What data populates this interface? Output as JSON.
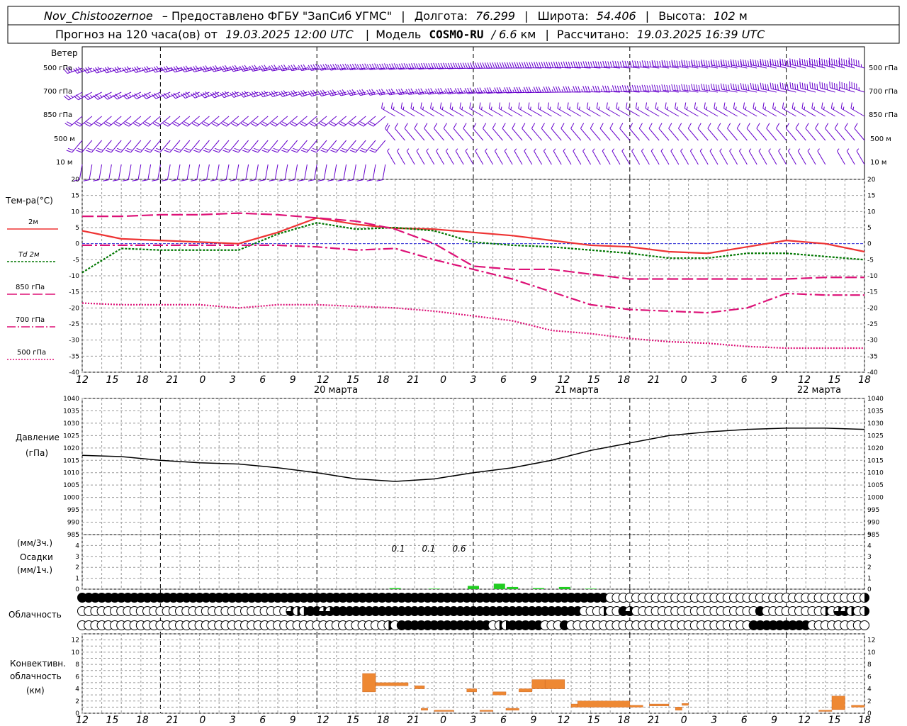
{
  "header": {
    "station": "Nov_Chistoozernoe",
    "provider_text": "– Предоставлено ФГБУ \"ЗапСиб УГМС\"",
    "lon_label": "Долгота:",
    "lon_value": "76.299",
    "lat_label": "Широта:",
    "lat_value": "54.406",
    "alt_label": "Высота:",
    "alt_value": "102",
    "alt_unit": "м",
    "forecast_label": "Прогноз на 120 часа(ов) от",
    "forecast_start": "19.03.2025 12:00 UTC",
    "model_label": "Модель",
    "model_name": "COSMO-RU",
    "model_res": "/ 6.6",
    "model_res_unit": "км",
    "calc_label": "Рассчитано:",
    "calc_time": "19.03.2025 16:39 UTC"
  },
  "time_axis": {
    "hour_labels": [
      "12",
      "15",
      "18",
      "21",
      "0",
      "3",
      "6",
      "9",
      "12",
      "15",
      "18",
      "21",
      "0",
      "3",
      "6",
      "9",
      "12",
      "15",
      "18",
      "21",
      "0",
      "3",
      "6",
      "9",
      "12",
      "15",
      "18"
    ],
    "dates": [
      "20 марта",
      "21 марта",
      "22 марта"
    ]
  },
  "colors": {
    "t2m": "#ee3333",
    "td2m": "#007700",
    "upper": "#dd1177",
    "wind": "#6600cc",
    "pressure": "#000000",
    "precip": "#22cc22",
    "convective": "#ee8833",
    "zero_line": "#3333dd",
    "grid": "#999999"
  },
  "wind_panel": {
    "title": "Ветер",
    "levels": [
      "500 гПа",
      "700 гПа",
      "850 гПа",
      "500 м",
      "10  м"
    ]
  },
  "temp_panel": {
    "title": "Тем-ра(°С)",
    "legend": [
      {
        "id": "t2m",
        "label": "2м"
      },
      {
        "id": "td2m",
        "label": "Td  2м"
      },
      {
        "id": "t850",
        "label": "850 гПа"
      },
      {
        "id": "t700",
        "label": "700 гПа"
      },
      {
        "id": "t500",
        "label": "500 гПа"
      }
    ],
    "y_ticks": [
      "20",
      "15",
      "10",
      "5",
      "0",
      "-5",
      "-10",
      "-15",
      "-20",
      "-25",
      "-30",
      "-35",
      "-40"
    ]
  },
  "pressure_panel": {
    "title": "Давление",
    "unit": "(гПа)",
    "y_ticks": [
      "1040",
      "1035",
      "1030",
      "1025",
      "1020",
      "1015",
      "1010",
      "1005",
      "1000",
      "995",
      "990",
      "985"
    ]
  },
  "precip_panel": {
    "unit_top": "(мм/3ч.)",
    "title": "Осадки",
    "unit_bottom": "(мм/1ч.)",
    "y_ticks": [
      "5",
      "4",
      "3",
      "2",
      "1",
      "0"
    ],
    "totals": [
      "0.1",
      "0.1",
      "0.6"
    ]
  },
  "cloud_panel": {
    "title": "Облачность"
  },
  "conv_panel": {
    "title_1": "Конвективн.",
    "title_2": "облачность",
    "unit": "(км)",
    "y_ticks": [
      "12",
      "10",
      "8",
      "6",
      "4",
      "2",
      "0"
    ]
  },
  "chart_data": {
    "type": "line",
    "x_hours": [
      0,
      6,
      12,
      18,
      24,
      30,
      36,
      42,
      48,
      54,
      60,
      66,
      72,
      78,
      84,
      90,
      96,
      102,
      108,
      114,
      120
    ],
    "series": [
      {
        "name": "2м",
        "values": [
          4,
          1.5,
          1,
          0.5,
          0,
          3.5,
          8,
          6,
          4.8,
          4.5,
          3.5,
          2.5,
          1,
          -0.5,
          -1,
          -2.5,
          -3,
          -1,
          1,
          0,
          -2.5
        ]
      },
      {
        "name": "Td  2м",
        "values": [
          -9,
          -1.5,
          -2,
          -2,
          -2,
          3,
          6.5,
          4.5,
          5,
          4,
          0.5,
          -0.5,
          -1,
          -2,
          -3,
          -4.5,
          -4.5,
          -3,
          -3,
          -4,
          -5
        ]
      },
      {
        "name": "850 гПа",
        "values": [
          8.5,
          8.5,
          9,
          9,
          9.5,
          9,
          8,
          7,
          4.5,
          0,
          -7,
          -8,
          -8,
          -9.5,
          -11,
          -11,
          -11,
          -11,
          -11,
          -10.5,
          -10.5
        ]
      },
      {
        "name": "700 гПа",
        "values": [
          -0.5,
          -0.5,
          -0.5,
          -0.5,
          -0.5,
          -0.5,
          -1,
          -2,
          -1.5,
          -5,
          -8,
          -11,
          -15,
          -19,
          -20.5,
          -21,
          -21.5,
          -20,
          -15.5,
          -16,
          -16
        ]
      },
      {
        "name": "500 гПа",
        "values": [
          -18.5,
          -19,
          -19,
          -19,
          -20,
          -19,
          -19,
          -19.5,
          -20,
          -21,
          -22.5,
          -24,
          -27,
          -28,
          -29.5,
          -30.5,
          -31,
          -32,
          -32.5,
          -32.5,
          -32.5
        ]
      }
    ],
    "pressure": {
      "values": [
        1017,
        1016.5,
        1015,
        1014,
        1013.5,
        1012,
        1010,
        1007.5,
        1006.5,
        1007.5,
        1010,
        1012,
        1015,
        1019,
        1022,
        1025,
        1026.5,
        1027.5,
        1028,
        1028,
        1027.5
      ],
      "ylim": [
        985,
        1040
      ]
    },
    "precip_3h": {
      "hours": [
        48,
        54,
        60,
        64,
        66,
        70,
        74,
        78
      ],
      "values": [
        0.1,
        0.05,
        0.3,
        0.5,
        0.2,
        0.1,
        0.2,
        0.05
      ]
    },
    "convective": {
      "segments": [
        {
          "from": 43,
          "to": 45,
          "bottom": 3.5,
          "top": 6.5
        },
        {
          "from": 45,
          "to": 50,
          "bottom": 4.5,
          "top": 5
        },
        {
          "from": 51,
          "to": 52.5,
          "bottom": 4,
          "top": 4.5
        },
        {
          "from": 52,
          "to": 53,
          "bottom": 0.5,
          "top": 0.8
        },
        {
          "from": 54,
          "to": 57,
          "bottom": 0.3,
          "top": 0.5
        },
        {
          "from": 59,
          "to": 60.5,
          "bottom": 3.5,
          "top": 4
        },
        {
          "from": 61,
          "to": 63,
          "bottom": 0.3,
          "top": 0.5
        },
        {
          "from": 63,
          "to": 65,
          "bottom": 3,
          "top": 3.5
        },
        {
          "from": 65,
          "to": 67,
          "bottom": 0.5,
          "top": 0.8
        },
        {
          "from": 67,
          "to": 69,
          "bottom": 3.5,
          "top": 4
        },
        {
          "from": 69,
          "to": 71,
          "bottom": 4,
          "top": 5.5
        },
        {
          "from": 71,
          "to": 74,
          "bottom": 4,
          "top": 5.5
        },
        {
          "from": 75,
          "to": 76,
          "bottom": 1,
          "top": 1.5
        },
        {
          "from": 76,
          "to": 84,
          "bottom": 1,
          "top": 2
        },
        {
          "from": 84,
          "to": 86,
          "bottom": 1,
          "top": 1.3
        },
        {
          "from": 87,
          "to": 90,
          "bottom": 1.2,
          "top": 1.5
        },
        {
          "from": 91,
          "to": 92,
          "bottom": 0.5,
          "top": 1
        },
        {
          "from": 92,
          "to": 93,
          "bottom": 1.3,
          "top": 1.6
        },
        {
          "from": 113,
          "to": 115,
          "bottom": 0.3,
          "top": 0.5
        },
        {
          "from": 115,
          "to": 117,
          "bottom": 0.6,
          "top": 2.8
        },
        {
          "from": 118,
          "to": 120,
          "bottom": 1,
          "top": 1.3
        }
      ]
    },
    "cloud_rows_cover": [
      [
        8,
        8,
        8,
        8,
        8,
        8,
        8,
        8,
        8,
        8,
        8,
        8,
        8,
        8,
        8,
        8,
        8,
        8,
        8,
        8,
        8,
        8,
        8,
        8,
        8,
        8,
        8,
        8,
        8,
        8,
        8,
        8,
        8,
        8,
        8,
        8,
        8,
        8,
        8,
        8,
        8,
        8,
        8,
        8,
        8,
        8,
        8,
        8,
        8,
        8,
        8,
        8,
        8,
        8,
        8,
        8,
        8,
        8,
        8,
        8,
        8,
        8,
        8,
        8,
        8,
        8,
        8,
        8,
        8,
        8,
        8,
        8,
        8,
        8,
        8,
        8,
        8,
        8,
        8,
        8,
        8,
        0,
        0,
        0,
        0,
        0,
        0,
        0,
        0,
        0,
        0,
        0,
        0,
        0,
        0,
        0,
        0,
        0,
        0,
        0,
        0,
        0,
        0,
        0,
        0,
        0,
        0,
        0,
        0,
        0,
        0,
        0,
        0,
        0,
        0,
        0,
        0,
        0,
        0,
        0,
        4
      ],
      [
        0,
        0,
        0,
        0,
        0,
        0,
        0,
        0,
        0,
        0,
        0,
        0,
        0,
        0,
        0,
        0,
        0,
        0,
        0,
        0,
        0,
        0,
        0,
        0,
        0,
        0,
        0,
        0,
        0,
        0,
        0,
        0,
        6,
        4,
        4,
        8,
        8,
        6,
        6,
        8,
        8,
        8,
        8,
        8,
        8,
        8,
        8,
        8,
        8,
        8,
        8,
        8,
        8,
        8,
        8,
        8,
        8,
        8,
        8,
        8,
        8,
        8,
        8,
        8,
        8,
        8,
        8,
        8,
        8,
        8,
        8,
        8,
        8,
        8,
        8,
        8,
        8,
        0,
        0,
        0,
        4,
        0,
        0,
        8,
        6,
        0,
        0,
        0,
        0,
        0,
        0,
        0,
        0,
        0,
        0,
        0,
        0,
        0,
        0,
        0,
        0,
        0,
        0,
        0,
        8,
        0,
        0,
        0,
        0,
        0,
        0,
        0,
        0,
        0,
        4,
        0,
        6,
        6,
        4,
        0,
        4
      ],
      [
        0,
        0,
        0,
        0,
        0,
        0,
        0,
        0,
        0,
        0,
        0,
        0,
        0,
        0,
        0,
        0,
        0,
        0,
        0,
        0,
        0,
        0,
        0,
        0,
        0,
        0,
        0,
        0,
        0,
        0,
        0,
        0,
        0,
        0,
        0,
        0,
        0,
        0,
        0,
        0,
        0,
        0,
        0,
        0,
        0,
        0,
        0,
        4,
        0,
        8,
        8,
        8,
        8,
        8,
        8,
        8,
        8,
        8,
        8,
        8,
        8,
        8,
        8,
        0,
        4,
        4,
        8,
        8,
        8,
        8,
        8,
        0,
        0,
        0,
        8,
        0,
        0,
        0,
        0,
        0,
        0,
        0,
        0,
        0,
        0,
        0,
        0,
        0,
        0,
        0,
        0,
        0,
        0,
        0,
        0,
        0,
        0,
        0,
        0,
        0,
        0,
        0,
        0,
        8,
        8,
        8,
        8,
        8,
        8,
        8,
        8,
        8,
        0,
        0,
        0,
        0,
        0,
        0,
        0,
        0,
        0
      ]
    ]
  }
}
